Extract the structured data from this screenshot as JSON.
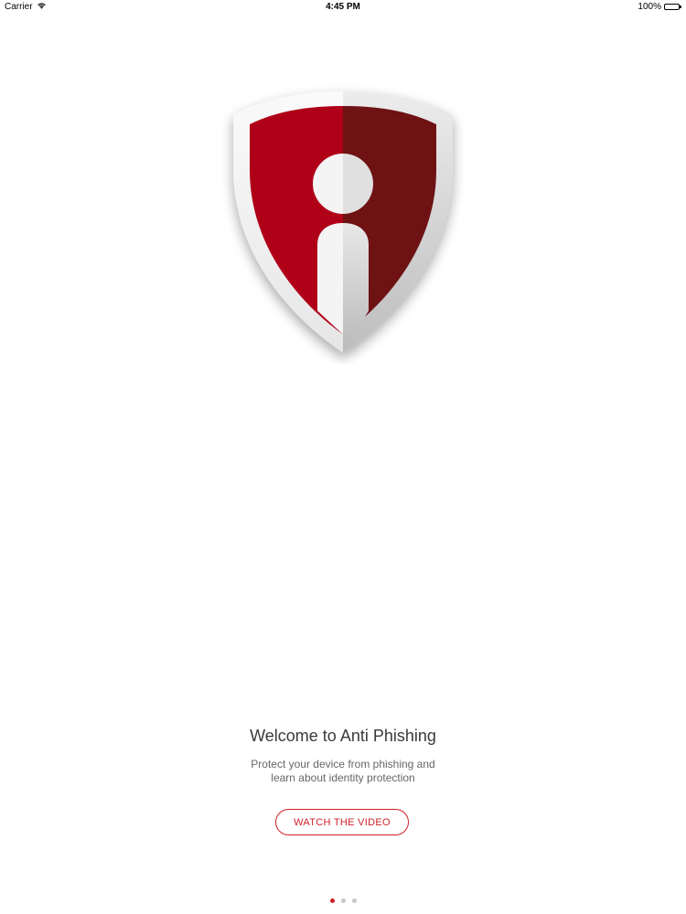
{
  "status_bar": {
    "carrier": "Carrier",
    "time": "4:45 PM",
    "battery": "100%",
    "battery_level": 1.0,
    "icons": [
      "wifi-icon",
      "battery-icon"
    ]
  },
  "logo": {
    "icon": "shield-info-logo",
    "colors": {
      "red_light": "#b00018",
      "red_dark": "#6e1214",
      "rim_light": "#f2f2f2",
      "rim_dark": "#c8c8c8"
    }
  },
  "welcome": {
    "title": "Welcome to Anti Phishing",
    "subtitle_line1": "Protect your device from phishing and",
    "subtitle_line2": "learn about identity protection",
    "button_label": "WATCH THE VIDEO"
  },
  "pagination": {
    "pages": 3,
    "current": 1
  },
  "colors": {
    "accent": "#d0202a",
    "inactive_dot": "#c8c8c8"
  }
}
